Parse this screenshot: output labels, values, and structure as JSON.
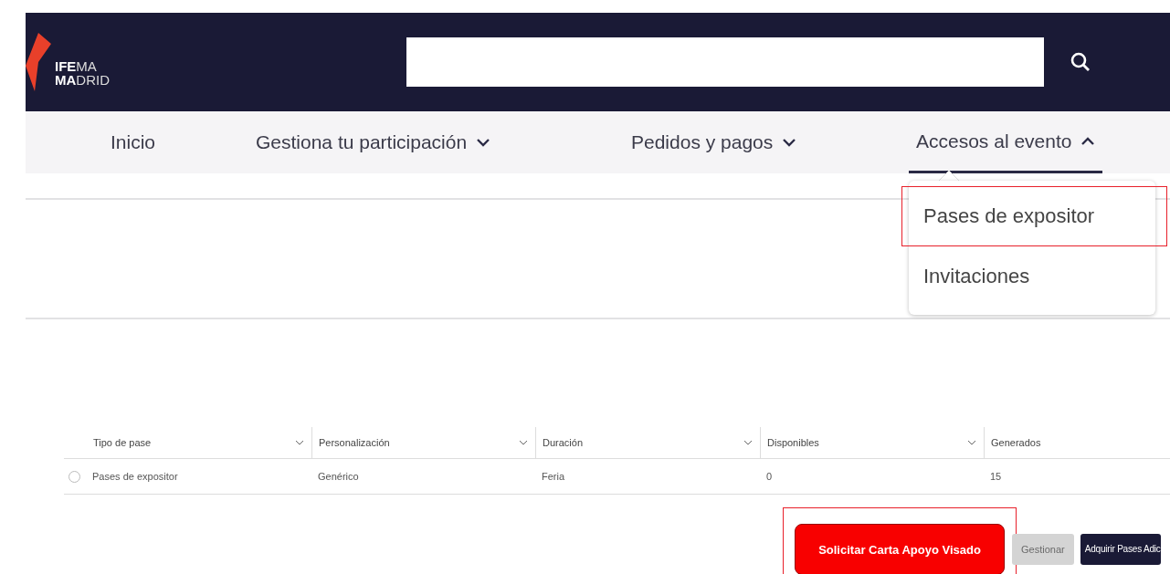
{
  "header": {
    "logo": {
      "line_1_bold": "IFE",
      "line_1_rest": "MA",
      "line_2_bold": "MA",
      "line_2_rest": "DRID"
    }
  },
  "nav": [
    {
      "label": "Inicio",
      "kind": "link"
    },
    {
      "label": "Gestiona tu participación",
      "kind": "menu",
      "expanded": false
    },
    {
      "label": "Pedidos y pagos",
      "kind": "menu",
      "expanded": false
    },
    {
      "label": "Accesos al evento",
      "kind": "menu",
      "expanded": true
    }
  ],
  "dropdown": [
    {
      "label": "Pases de expositor",
      "highlighted": true
    },
    {
      "label": "Invitaciones",
      "highlighted": false
    }
  ],
  "table": {
    "columns": [
      "Tipo de pase",
      "Personalización",
      "Duración",
      "Disponibles",
      "Generados"
    ],
    "rows": [
      {
        "selected": false,
        "cells": [
          "Pases de expositor",
          "Genérico",
          "Feria",
          "0",
          "15"
        ]
      }
    ]
  },
  "buttons": [
    {
      "label": "Solicitar Carta Apoyo Visado",
      "kind": "primary",
      "highlighted": true
    },
    {
      "label": "Gestionar",
      "kind": "secondary",
      "disabled": true
    },
    {
      "label": "Adquirir Pases Adic",
      "kind": "dark",
      "disabled": false
    }
  ]
}
